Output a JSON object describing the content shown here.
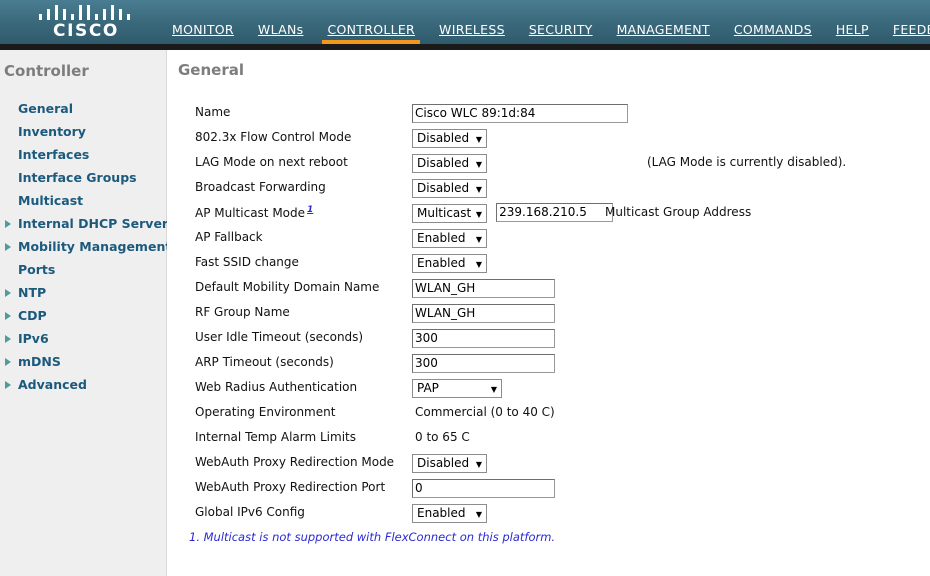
{
  "header": {
    "logo_text": "CISCO",
    "logo_icon": "cisco-bars-logo",
    "nav": [
      {
        "label": "MONITOR",
        "accel_index": 1,
        "active": false
      },
      {
        "label": "WLANs",
        "accel_index": 1,
        "active": false
      },
      {
        "label": "CONTROLLER",
        "accel_index": 0,
        "active": true
      },
      {
        "label": "WIRELESS",
        "accel_index": 1,
        "active": false
      },
      {
        "label": "SECURITY",
        "accel_index": 0,
        "active": false
      },
      {
        "label": "MANAGEMENT",
        "accel_index": 1,
        "active": false
      },
      {
        "label": "COMMANDS",
        "accel_index": 1,
        "active": false
      },
      {
        "label": "HELP",
        "accel_index": 3,
        "active": false
      },
      {
        "label": "FEEDBACK",
        "accel_index": 0,
        "active": false
      }
    ]
  },
  "sidebar": {
    "title": "Controller",
    "items": [
      {
        "label": "General",
        "expandable": false
      },
      {
        "label": "Inventory",
        "expandable": false
      },
      {
        "label": "Interfaces",
        "expandable": false
      },
      {
        "label": "Interface Groups",
        "expandable": false
      },
      {
        "label": "Multicast",
        "expandable": false
      },
      {
        "label": "Internal DHCP Server",
        "expandable": true
      },
      {
        "label": "Mobility Management",
        "expandable": true
      },
      {
        "label": "Ports",
        "expandable": false
      },
      {
        "label": "NTP",
        "expandable": true
      },
      {
        "label": "CDP",
        "expandable": true
      },
      {
        "label": "IPv6",
        "expandable": true
      },
      {
        "label": "mDNS",
        "expandable": true
      },
      {
        "label": "Advanced",
        "expandable": true
      }
    ]
  },
  "main": {
    "title": "General",
    "fields": {
      "name_label": "Name",
      "name_value": "Cisco WLC 89:1d:84",
      "flow_control_label": "802.3x Flow Control Mode",
      "flow_control_value": "Disabled",
      "lag_label": "LAG Mode on next reboot",
      "lag_value": "Disabled",
      "lag_note": "(LAG Mode is currently disabled).",
      "broadcast_label": "Broadcast Forwarding",
      "broadcast_value": "Disabled",
      "ap_multicast_label": "AP Multicast Mode",
      "ap_multicast_footnote_marker": "1",
      "ap_multicast_value": "Multicast",
      "multicast_group_address": "239.168.210.5",
      "multicast_group_label": "Multicast Group Address",
      "ap_fallback_label": "AP Fallback",
      "ap_fallback_value": "Enabled",
      "fast_ssid_label": "Fast SSID change",
      "fast_ssid_value": "Enabled",
      "mobility_domain_label": "Default Mobility Domain Name",
      "mobility_domain_value": "WLAN_GH",
      "rf_group_label": "RF Group Name",
      "rf_group_value": "WLAN_GH",
      "user_idle_label": "User Idle Timeout (seconds)",
      "user_idle_value": "300",
      "arp_timeout_label": "ARP Timeout (seconds)",
      "arp_timeout_value": "300",
      "web_radius_label": "Web Radius Authentication",
      "web_radius_value": "PAP",
      "operating_env_label": "Operating Environment",
      "operating_env_value": "Commercial (0 to 40 C)",
      "temp_alarm_label": "Internal Temp Alarm Limits",
      "temp_alarm_value": "0 to 65 C",
      "webauth_mode_label": "WebAuth Proxy Redirection Mode",
      "webauth_mode_value": "Disabled",
      "webauth_port_label": "WebAuth Proxy Redirection Port",
      "webauth_port_value": "0",
      "global_ipv6_label": "Global IPv6 Config",
      "global_ipv6_value": "Enabled"
    },
    "footnote": "1. Multicast is not supported with FlexConnect on this platform."
  },
  "colors": {
    "header_top": "#4a7d92",
    "header_bottom": "#2f5a6c",
    "accent_orange": "#f2971f",
    "sidebar_bg": "#efefef",
    "link_blue": "#1c5a7d",
    "arrow_teal": "#4f9a9a",
    "footnote_blue": "#2a2ad0",
    "heading_gray": "#7d7d7d"
  }
}
